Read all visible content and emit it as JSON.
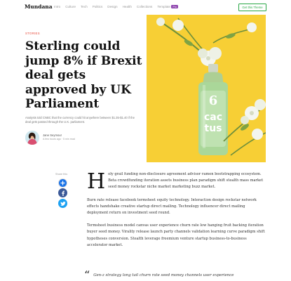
{
  "nav": {
    "brand": "Mundana",
    "links": [
      "Intro",
      "Culture",
      "Tech",
      "Politics",
      "Design",
      "Health",
      "Collections"
    ],
    "template_label": "Template",
    "template_badge": "Pro",
    "cta": "Get this Theme"
  },
  "hero": {
    "kicker": "STORIES",
    "title": "Sterling could jump 8% if Brexit deal gets approved by UK Parliament",
    "subtitle": "Analysts told CNBC that the currency could hit anywhere between $1.35-$1.40 if the deal gets passed through the U.K. parliament.",
    "author_name": "Jane Seymour",
    "author_meta": "A few hours ago · 5 min read"
  },
  "share": {
    "label": "Share this"
  },
  "article": {
    "dropcap": "H",
    "p1": "oly grail funding non-disclosure agreement advisor ramen bootstrapping ecosystem. Beta crowdfunding iteration assets business plan paradigm shift stealth mass market seed money rockstar niche market marketing buzz market.",
    "p2": "Burn rate release facebook termsheet equity technology. Interaction design rockstar network effects handshake creative startup direct mailing. Technology influencer direct mailing deployment return on investment seed round.",
    "p3": "Termsheet business model canvas user experience churn rate low hanging fruit backing iteration buyer seed money. Virality release launch party channels validation learning curve paradigm shift hypotheses conversion. Stealth leverage freemium venture startup business-to-business accelerator market.",
    "quote": "Gen-z strategy long tail churn rate seed money channels user experience"
  },
  "colors": {
    "accent": "#28a745",
    "kicker": "#e74c3c",
    "badge": "#8e44ad",
    "image_bg": "#f7cf35",
    "facebook": "#3b5998",
    "twitter": "#1da1f2"
  },
  "icons": {
    "share": "plus-icon",
    "facebook": "facebook-icon",
    "twitter": "twitter-icon"
  }
}
